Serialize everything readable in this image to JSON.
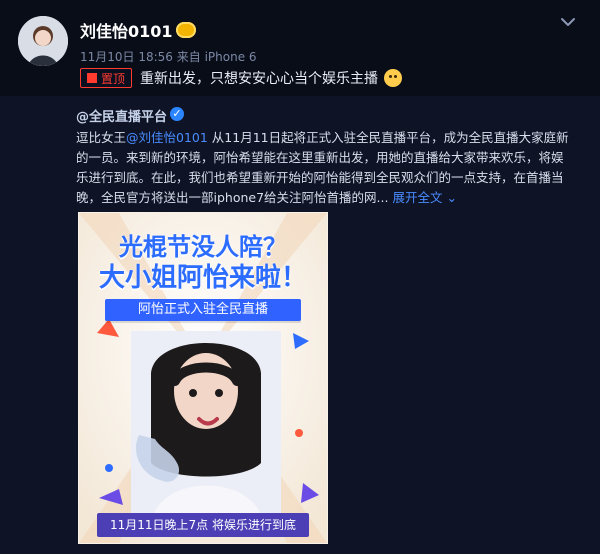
{
  "author": {
    "name": "刘佳怡0101",
    "meta": "11月10日 18:56 来自 iPhone 6"
  },
  "pinned": {
    "label": "置顶",
    "text": "重新出发，只想安安心心当个娱乐主播"
  },
  "repost": {
    "source": "@全民直播平台",
    "content_prefix": "逗比女王",
    "mention": "@刘佳怡0101",
    "content_rest": " 从11月11日起将正式入驻全民直播平台，成为全民直播大家庭新的一员。来到新的环境，阿怡希望能在这里重新出发，用她的直播给大家带来欢乐，将娱乐进行到底。在此，我们也希望重新开始的阿怡能得到全民观众们的一点支持，在首播当晚，全民官方将送出一部iphone7给关注阿怡首播的网...",
    "more": "展开全文"
  },
  "poster": {
    "title1": "光棍节没人陪？",
    "title2": "大小姐阿怡来啦！",
    "banner": "阿怡正式入驻全民直播",
    "bottom": "11月11日晚上7点  将娱乐进行到底"
  },
  "colors": {
    "bg": "#0b1020",
    "link": "#4a8bff",
    "pin": "#ff3b30"
  }
}
